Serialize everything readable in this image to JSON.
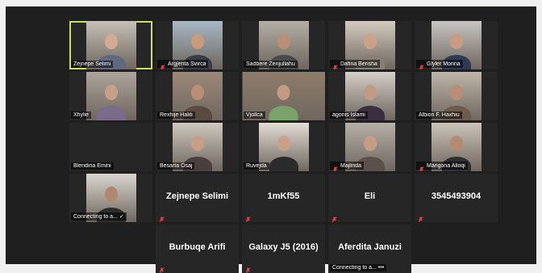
{
  "participants": [
    {
      "name": "Zejnepe Selimi",
      "muted": false,
      "video": true,
      "active": true,
      "skin": "#d3ab92",
      "bg": "#c6c0b6",
      "shirt": "#5f6a80"
    },
    {
      "name": "Argjenta Svirca",
      "muted": true,
      "video": true,
      "skin": "#c99a7c",
      "bg": "#a7b8c5",
      "shirt": "#3c3c48"
    },
    {
      "name": "Sadbere Zenjullahu",
      "muted": false,
      "video": true,
      "skin": "#b98f76",
      "bg": "#b4aea5",
      "shirt": "#4a4a4a"
    },
    {
      "name": "Dafina Berisha",
      "muted": true,
      "video": true,
      "skin": "#caa287",
      "bg": "#d3cbbf",
      "shirt": "#8b7e72"
    },
    {
      "name": "Glyler Morina",
      "muted": true,
      "video": true,
      "skin": "#c99b82",
      "bg": "#c7c5c2",
      "shirt": "#2f3a55"
    },
    {
      "name": "Xhylie",
      "muted": false,
      "video": true,
      "skin": "#c7a08b",
      "bg": "#ada59a",
      "shirt": "#7c6a8c"
    },
    {
      "name": "Rexhije Haliti",
      "muted": false,
      "video": true,
      "skin": "#b88e74",
      "bg": "#9b8878",
      "shirt": "#5b4a42"
    },
    {
      "name": "Vjollca",
      "muted": false,
      "video": true,
      "wide": true,
      "skin": "#c49a82",
      "bg": "#8f7c6a",
      "shirt": "#7aa36a"
    },
    {
      "name": "agonis Islami",
      "muted": false,
      "video": true,
      "skin": "#c19b84",
      "bg": "#d4cfc8",
      "shirt": "#3a2f3e"
    },
    {
      "name": "Albion F. Haxhiu",
      "muted": false,
      "video": true,
      "skin": "#b88f76",
      "bg": "#bfb6a9",
      "shirt": "#6e5b4b"
    },
    {
      "name": "Blendina Emini",
      "muted": false,
      "video": false
    },
    {
      "name": "Besarta Osaj",
      "muted": false,
      "video": true,
      "skin": "#c99e82",
      "bg": "#cfc8be",
      "shirt": "#4a3e3e"
    },
    {
      "name": "Ruvejda",
      "muted": false,
      "video": true,
      "skin": "#c8a188",
      "bg": "#e2ddd5",
      "shirt": "#2b2b2b"
    },
    {
      "name": "Majlinda",
      "muted": true,
      "video": true,
      "skin": "#c59d85",
      "bg": "#b5b0a8",
      "shirt": "#5d4f4a"
    },
    {
      "name": "Marigona Alloqi",
      "muted": true,
      "video": true,
      "skin": "#b48a70",
      "bg": "#cbc4ba",
      "shirt": "#2e2e34"
    },
    {
      "name": "Connecting to a... ✓",
      "muted": false,
      "video": true,
      "skin": "#b08870",
      "bg": "#dad6cf",
      "shirt": "#2d2d2d"
    },
    {
      "name": "",
      "muted": true,
      "video": false,
      "bigname": "Zejnepe Selimi"
    },
    {
      "name": "",
      "muted": true,
      "video": false,
      "bigname": "1mKf55"
    },
    {
      "name": "",
      "muted": true,
      "video": false,
      "bigname": "Eli"
    },
    {
      "name": "",
      "muted": true,
      "video": false,
      "bigname": "3545493904"
    },
    {
      "name": "",
      "muted": false,
      "video": false,
      "blank": true
    },
    {
      "name": "",
      "muted": true,
      "video": false,
      "bigname": "Burbuqe Arifi"
    },
    {
      "name": "",
      "muted": true,
      "video": false,
      "bigname": "Galaxy J5 (2016)"
    },
    {
      "name": "Connecting to a... •••",
      "muted": false,
      "video": false,
      "bigname": "Aferdita Januzi"
    }
  ],
  "colors": {
    "active_border": "#c8e05a",
    "muted_icon": "#e8404a",
    "tile_bg": "#262626"
  }
}
